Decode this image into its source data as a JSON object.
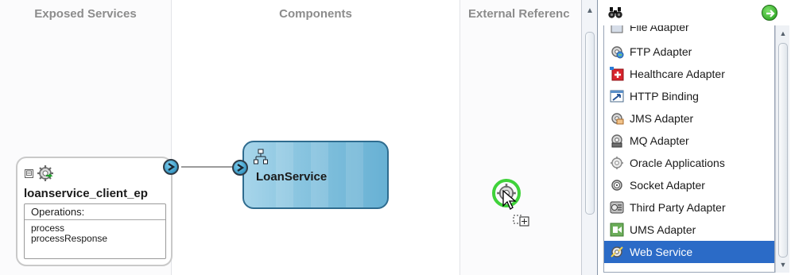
{
  "lanes": {
    "exposed_services": "Exposed Services",
    "components": "Components",
    "external_references": "External Referenc"
  },
  "service": {
    "collapse_symbol": "⊟",
    "title": "loanservice_client_ep",
    "operations_label": "Operations:",
    "operations": [
      "process",
      "processResponse"
    ]
  },
  "component": {
    "title": "LoanService"
  },
  "palette": {
    "partial_item": "File Adapter",
    "items": [
      {
        "label": "FTP Adapter",
        "icon": "ftp-adapter-icon"
      },
      {
        "label": "Healthcare Adapter",
        "icon": "healthcare-adapter-icon"
      },
      {
        "label": "HTTP Binding",
        "icon": "http-binding-icon"
      },
      {
        "label": "JMS Adapter",
        "icon": "jms-adapter-icon"
      },
      {
        "label": "MQ Adapter",
        "icon": "mq-adapter-icon"
      },
      {
        "label": "Oracle Applications",
        "icon": "oracle-applications-icon"
      },
      {
        "label": "Socket Adapter",
        "icon": "socket-adapter-icon"
      },
      {
        "label": "Third Party Adapter",
        "icon": "third-party-adapter-icon"
      },
      {
        "label": "UMS Adapter",
        "icon": "ums-adapter-icon"
      },
      {
        "label": "Web Service",
        "icon": "web-service-icon",
        "selected": true
      }
    ]
  },
  "colors": {
    "accent_selection": "#2b6bc7",
    "component_fill": "#7cbddb",
    "drop_indicator": "#3fd23a"
  }
}
